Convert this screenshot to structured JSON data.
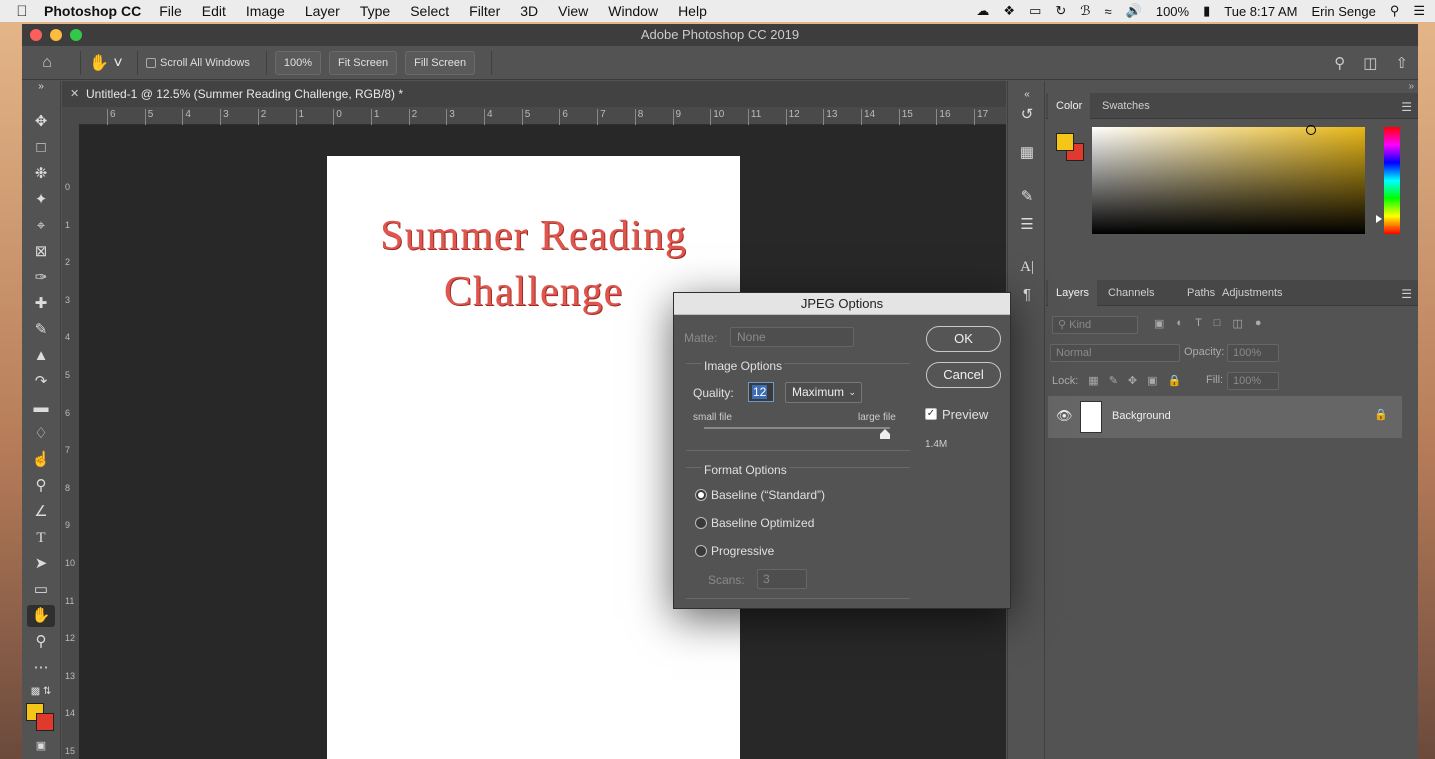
{
  "menubar": {
    "app": "Photoshop CC",
    "items": [
      "File",
      "Edit",
      "Image",
      "Layer",
      "Type",
      "Select",
      "Filter",
      "3D",
      "View",
      "Window",
      "Help"
    ],
    "battery": "100%",
    "time": "Tue 8:17 AM",
    "user": "Erin Senge"
  },
  "window": {
    "title": "Adobe Photoshop CC 2019"
  },
  "options": {
    "scroll_all": "Scroll All Windows",
    "zoom": "100%",
    "fit": "Fit Screen",
    "fill": "Fill Screen"
  },
  "document": {
    "tab": "Untitled-1 @ 12.5% (Summer Reading  Challenge, RGB/8) *",
    "headline_line1": "Summer Reading",
    "headline_line2": "Challenge"
  },
  "ruler": {
    "h_ticks": [
      "6",
      "5",
      "4",
      "3",
      "2",
      "1",
      "0",
      "1",
      "2",
      "3",
      "4",
      "5",
      "6",
      "7",
      "8",
      "9",
      "10",
      "11",
      "12",
      "13",
      "14",
      "15",
      "16",
      "17"
    ],
    "v_ticks": [
      "0",
      "1",
      "2",
      "3",
      "4",
      "5",
      "6",
      "7",
      "8",
      "9",
      "10",
      "11",
      "12",
      "13",
      "14",
      "15"
    ]
  },
  "color_panel": {
    "tabs": [
      "Color",
      "Swatches"
    ],
    "foreground": "#f5c518",
    "background": "#e03a2e"
  },
  "layers_panel": {
    "tabs": [
      "Layers",
      "Channels",
      "Paths",
      "Adjustments"
    ],
    "filter": "Kind",
    "blend": "Normal",
    "opacity_label": "Opacity:",
    "opacity": "100%",
    "lock_label": "Lock:",
    "fill_label": "Fill:",
    "fill": "100%",
    "layer_name": "Background"
  },
  "dialog": {
    "title": "JPEG Options",
    "matte_label": "Matte:",
    "matte_value": "None",
    "image_options": "Image Options",
    "quality_label": "Quality:",
    "quality_value": "12",
    "quality_preset": "Maximum",
    "small_file": "small file",
    "large_file": "large file",
    "quality_level": 1.0,
    "ok": "OK",
    "cancel": "Cancel",
    "preview": "Preview",
    "file_size": "1.4M",
    "format_options": "Format Options",
    "formats": [
      "Baseline (“Standard”)",
      "Baseline Optimized",
      "Progressive"
    ],
    "scans_label": "Scans:",
    "scans_value": "3"
  }
}
